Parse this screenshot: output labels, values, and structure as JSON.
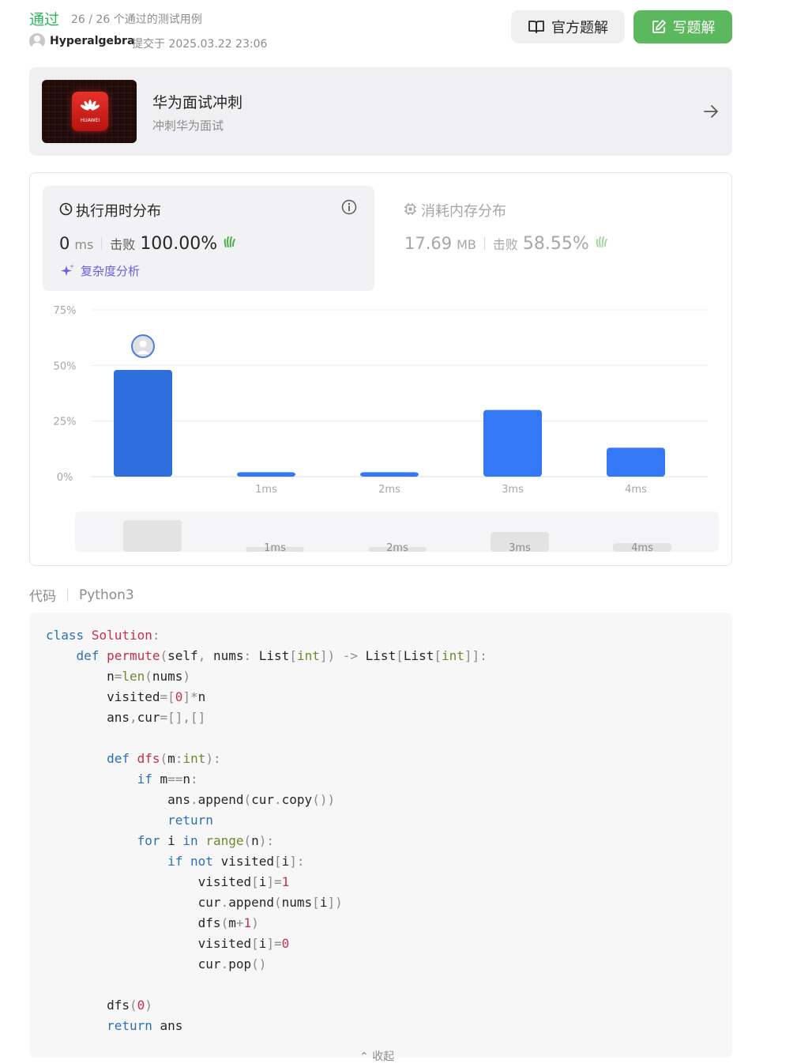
{
  "header": {
    "status": "通过",
    "cases": "26 / 26 个通过的测试用例",
    "username": "Hyperalgebra",
    "submitted": "提交于 2025.03.22 23:06",
    "official_label": "官方题解",
    "write_label": "写题解"
  },
  "banner": {
    "title": "华为面试冲刺",
    "subtitle": "冲刺华为面试",
    "logo_text": "HUAWEI"
  },
  "runtime": {
    "title": "执行用时分布",
    "value": "0",
    "unit": "ms",
    "beat_label": "击败",
    "beat_value": "100.00%",
    "analysis_label": "复杂度分析"
  },
  "memory": {
    "title": "消耗内存分布",
    "value": "17.69",
    "unit": "MB",
    "beat_label": "击败",
    "beat_value": "58.55%"
  },
  "chart_data": {
    "type": "bar",
    "categories": [
      "",
      "1ms",
      "2ms",
      "3ms",
      "4ms"
    ],
    "values": [
      48,
      2,
      2,
      30,
      13
    ],
    "yticks": [
      "75%",
      "50%",
      "25%",
      "0%"
    ],
    "ylim": [
      0,
      75
    ],
    "highlight_index": 0,
    "colors": {
      "highlight": "#2f6fdd",
      "bar": "#3478f6",
      "grid": "#ececec"
    },
    "mini_map": {
      "categories": [
        "",
        "1ms",
        "2ms",
        "3ms",
        "4ms"
      ]
    }
  },
  "code_section": {
    "label": "代码",
    "language": "Python3",
    "collapse_label": "收起"
  }
}
